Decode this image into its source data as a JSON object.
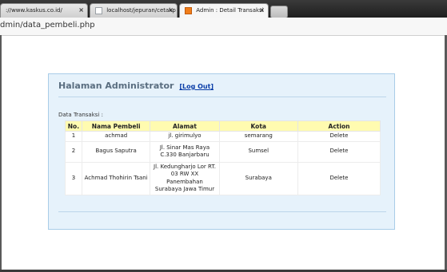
{
  "browser": {
    "tabs": [
      {
        "label": "://www.kaskus.co.id/",
        "close": "×"
      },
      {
        "label": "localhost/jepuran/cetakp",
        "close": "×"
      },
      {
        "label": "Admin : Detail Transaksi",
        "close": "×"
      }
    ],
    "address": "dmin/data_pembeli.php"
  },
  "page": {
    "title": "Halaman Administrator",
    "logout_label": "[Log Out]",
    "data_label": "Data Transaksi :",
    "table": {
      "headers": [
        "No.",
        "Nama Pembeli",
        "Alamat",
        "Kota",
        "Action"
      ],
      "rows": [
        {
          "no": "1",
          "nama": "achmad",
          "alamat": "jl. girimulyo",
          "kota": "semarang",
          "action": "Delete"
        },
        {
          "no": "2",
          "nama": "Bagus Saputra",
          "alamat": "Jl. Sinar Mas Raya C.330 Banjarbaru",
          "kota": "Sumsel",
          "action": "Delete"
        },
        {
          "no": "3",
          "nama": "Achmad Thohirin Tsani",
          "alamat": "Jl. Kedungharjo Lor RT. 03 RW XX Panembahan Surabaya Jawa Timur",
          "kota": "Surabaya",
          "action": "Delete"
        }
      ]
    }
  },
  "colors": {
    "panel_bg": "#e6f2fb",
    "header_bg": "#fffbb0",
    "link": "#0b3ea8"
  }
}
